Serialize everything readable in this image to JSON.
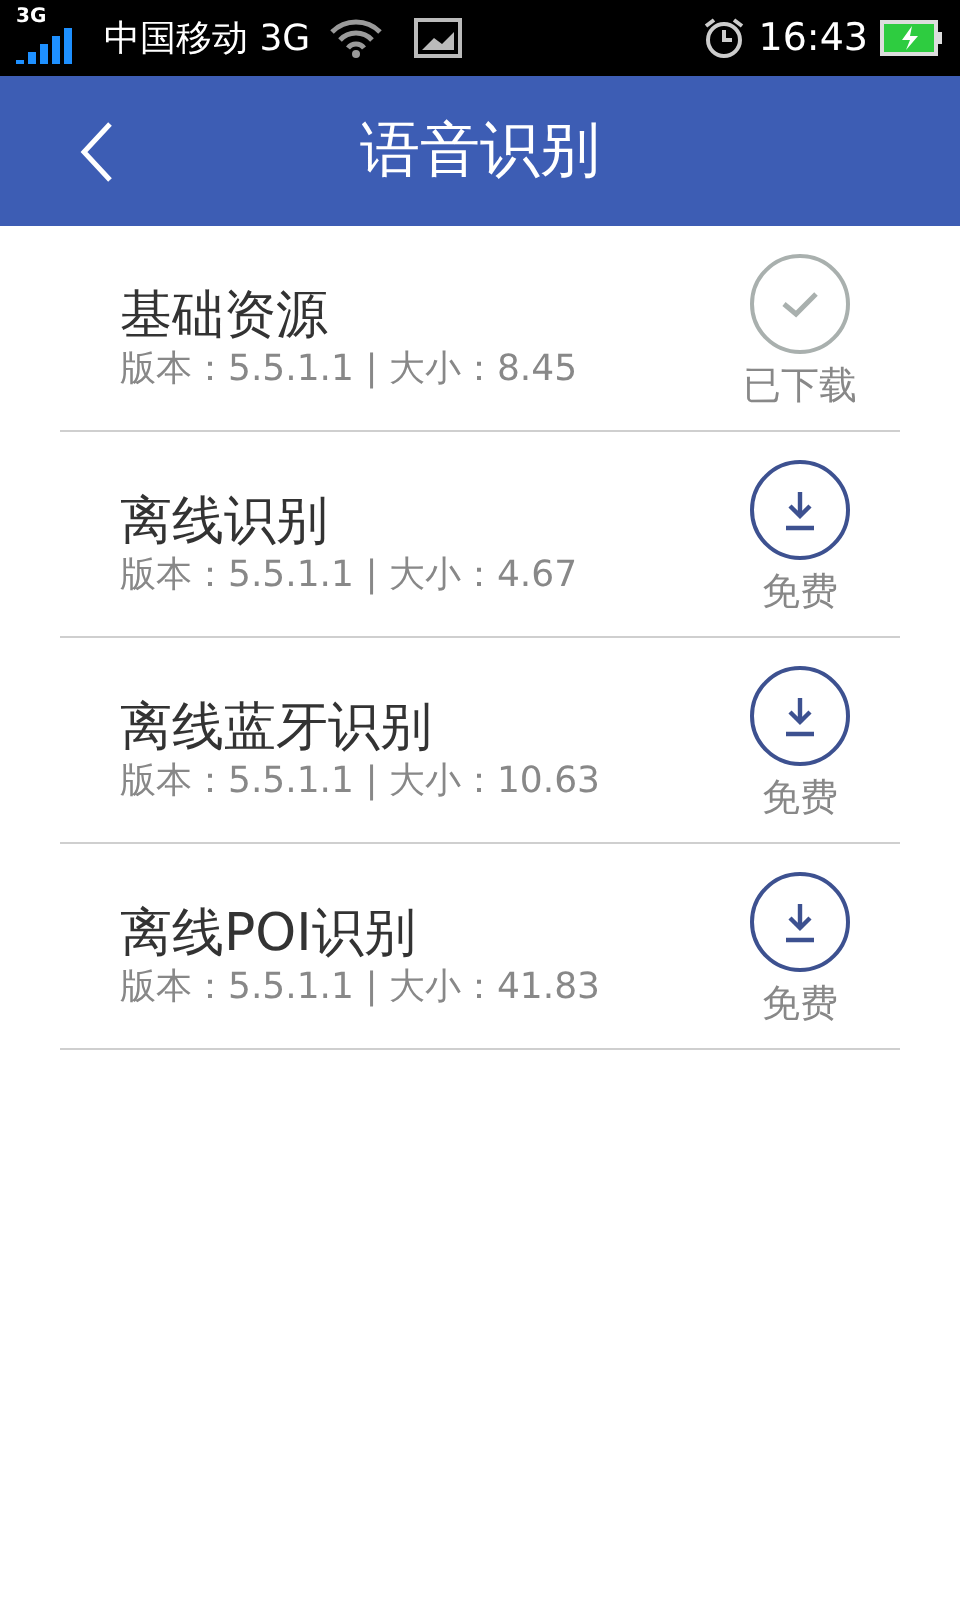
{
  "status_bar": {
    "network_badge": "3G",
    "carrier": "中国移动 3G",
    "time": "16:43"
  },
  "header": {
    "title": "语音识别"
  },
  "packages": [
    {
      "name": "基础资源",
      "info": "版本：5.5.1.1 | 大小：8.45",
      "downloaded": true,
      "action": "已下载"
    },
    {
      "name": "离线识别",
      "info": "版本：5.5.1.1 | 大小：4.67",
      "downloaded": false,
      "action": "免费"
    },
    {
      "name": "离线蓝牙识别",
      "info": "版本：5.5.1.1 | 大小：10.63",
      "downloaded": false,
      "action": "免费"
    },
    {
      "name": "离线POI识别",
      "info": "版本：5.5.1.1 | 大小：41.83",
      "downloaded": false,
      "action": "免费"
    }
  ]
}
